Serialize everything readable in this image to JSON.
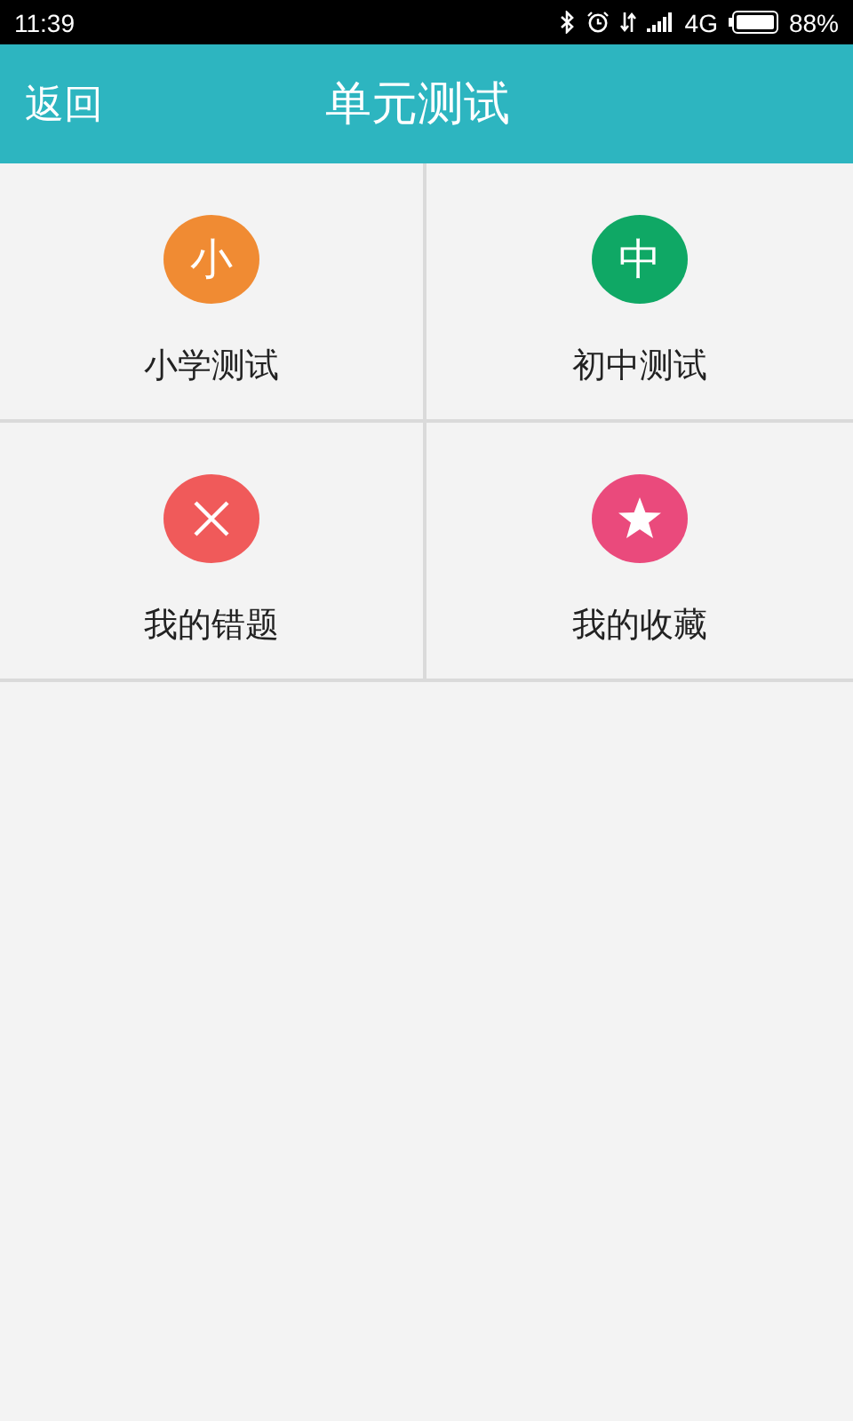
{
  "status_bar": {
    "time": "11:39",
    "network": "4G",
    "battery": "88%"
  },
  "header": {
    "back": "返回",
    "title": "单元测试"
  },
  "tiles": [
    {
      "label": "小学测试",
      "kind": "glyph",
      "glyph": "小",
      "color": "#f08b33"
    },
    {
      "label": "初中测试",
      "kind": "glyph",
      "glyph": "中",
      "color": "#0fa865"
    },
    {
      "label": "我的错题",
      "kind": "cross",
      "color": "#f05a5a"
    },
    {
      "label": "我的收藏",
      "kind": "star",
      "color": "#ea4a7c"
    }
  ]
}
